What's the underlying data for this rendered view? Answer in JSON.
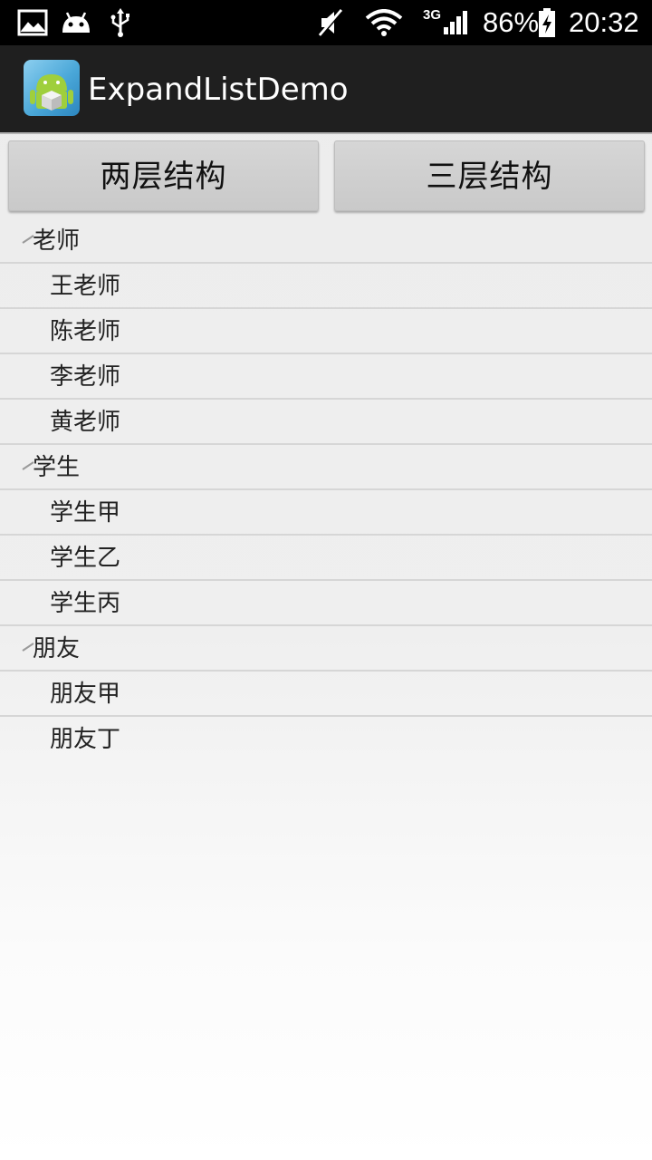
{
  "status_bar": {
    "icons": [
      "image-icon",
      "android-icon",
      "usb-icon",
      "mute-icon",
      "wifi-icon",
      "signal-3g-icon",
      "battery-charging-icon"
    ],
    "network_label": "3G",
    "battery_percent": "86%",
    "time": "20:32"
  },
  "action_bar": {
    "title": "ExpandListDemo",
    "icon": "android-cube-icon"
  },
  "buttons": {
    "two_level": "两层结构",
    "three_level": "三层结构"
  },
  "groups": [
    {
      "label": "老师",
      "children": [
        "王老师",
        "陈老师",
        "李老师",
        "黄老师"
      ]
    },
    {
      "label": "学生",
      "children": [
        "学生甲",
        "学生乙",
        "学生丙"
      ]
    },
    {
      "label": "朋友",
      "children": [
        "朋友甲",
        "朋友丁"
      ]
    }
  ],
  "colors": {
    "status_bar": "#000000",
    "action_bar": "#1f1f1f",
    "button": "#cfcfcf",
    "divider": "#d6d6d6",
    "text": "#222222"
  }
}
